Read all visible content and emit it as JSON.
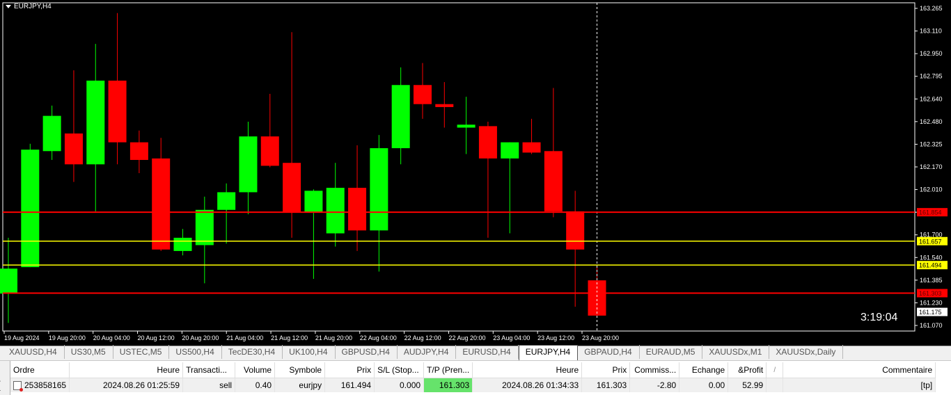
{
  "chart": {
    "title": "EURJPY,H4",
    "countdown": "3:19:04",
    "colors": {
      "background": "#000000",
      "bull": "#00ff00",
      "bear": "#ff0000",
      "axis": "#ffffff",
      "stop_line": "#ff0000",
      "entry_line": "#ffff00"
    }
  },
  "chart_data": {
    "type": "candlestick",
    "symbol": "EURJPY",
    "timeframe": "H4",
    "y_ticks": [
      "163.265",
      "163.110",
      "162.950",
      "162.795",
      "162.640",
      "162.480",
      "162.325",
      "162.170",
      "162.010",
      "161.855",
      "161.700",
      "161.540",
      "161.385",
      "161.230",
      "161.070"
    ],
    "x_ticks": [
      "19 Aug 2024",
      "19 Aug 20:00",
      "20 Aug 04:00",
      "20 Aug 12:00",
      "20 Aug 20:00",
      "21 Aug 04:00",
      "21 Aug 12:00",
      "21 Aug 20:00",
      "22 Aug 04:00",
      "22 Aug 12:00",
      "22 Aug 20:00",
      "23 Aug 04:00",
      "23 Aug 12:00",
      "23 Aug 20:00"
    ],
    "ylim": [
      161.045,
      163.28
    ],
    "price_labels": [
      {
        "price": 161.854,
        "label": "161.854",
        "kind": "stop"
      },
      {
        "price": 161.657,
        "label": "161.657",
        "kind": "entry"
      },
      {
        "price": 161.494,
        "label": "161.494",
        "kind": "entry"
      },
      {
        "price": 161.303,
        "label": "161.303",
        "kind": "stop"
      },
      {
        "price": 161.175,
        "label": "161.175",
        "kind": "bid"
      }
    ],
    "candles": [
      {
        "o": 161.3,
        "h": 161.68,
        "l": 161.1,
        "c": 161.47
      },
      {
        "o": 161.48,
        "h": 162.32,
        "l": 161.48,
        "c": 162.28
      },
      {
        "o": 162.27,
        "h": 162.58,
        "l": 162.21,
        "c": 162.51
      },
      {
        "o": 162.39,
        "h": 162.82,
        "l": 162.06,
        "c": 162.18
      },
      {
        "o": 162.18,
        "h": 163.0,
        "l": 161.86,
        "c": 162.75
      },
      {
        "o": 162.75,
        "h": 163.21,
        "l": 162.18,
        "c": 162.33
      },
      {
        "o": 162.33,
        "h": 162.41,
        "l": 162.12,
        "c": 162.21
      },
      {
        "o": 162.22,
        "h": 162.36,
        "l": 161.59,
        "c": 161.6
      },
      {
        "o": 161.59,
        "h": 161.74,
        "l": 161.56,
        "c": 161.68
      },
      {
        "o": 161.63,
        "h": 161.96,
        "l": 161.37,
        "c": 161.87
      },
      {
        "o": 161.87,
        "h": 162.05,
        "l": 161.64,
        "c": 161.99
      },
      {
        "o": 161.99,
        "h": 162.47,
        "l": 161.84,
        "c": 162.37
      },
      {
        "o": 162.37,
        "h": 162.66,
        "l": 162.16,
        "c": 162.17
      },
      {
        "o": 162.19,
        "h": 163.08,
        "l": 161.68,
        "c": 161.85
      },
      {
        "o": 161.85,
        "h": 162.01,
        "l": 161.4,
        "c": 162.0
      },
      {
        "o": 161.71,
        "h": 162.19,
        "l": 161.62,
        "c": 162.02
      },
      {
        "o": 162.02,
        "h": 162.31,
        "l": 161.59,
        "c": 161.73
      },
      {
        "o": 161.73,
        "h": 162.38,
        "l": 161.45,
        "c": 162.29
      },
      {
        "o": 162.29,
        "h": 162.84,
        "l": 162.18,
        "c": 162.72
      },
      {
        "o": 162.72,
        "h": 162.87,
        "l": 162.49,
        "c": 162.59
      },
      {
        "o": 162.59,
        "h": 162.74,
        "l": 162.43,
        "c": 162.57
      },
      {
        "o": 162.43,
        "h": 162.64,
        "l": 162.25,
        "c": 162.45
      },
      {
        "o": 162.44,
        "h": 162.47,
        "l": 161.68,
        "c": 162.22
      },
      {
        "o": 162.22,
        "h": 162.33,
        "l": 161.71,
        "c": 162.33
      },
      {
        "o": 162.33,
        "h": 162.49,
        "l": 162.25,
        "c": 162.26
      },
      {
        "o": 162.27,
        "h": 162.7,
        "l": 161.82,
        "c": 161.86
      },
      {
        "o": 161.86,
        "h": 162.0,
        "l": 161.21,
        "c": 161.6
      },
      {
        "o": 161.39,
        "h": 161.49,
        "l": 161.14,
        "c": 161.15
      }
    ]
  },
  "tabs": [
    {
      "label": "XAUUSD,H4",
      "active": false
    },
    {
      "label": "US30,M5",
      "active": false
    },
    {
      "label": "USTEC,M5",
      "active": false
    },
    {
      "label": "US500,H4",
      "active": false
    },
    {
      "label": "TecDE30,H4",
      "active": false
    },
    {
      "label": "UK100,H4",
      "active": false
    },
    {
      "label": "GBPUSD,H4",
      "active": false
    },
    {
      "label": "AUDJPY,H4",
      "active": false
    },
    {
      "label": "EURUSD,H4",
      "active": false
    },
    {
      "label": "EURJPY,H4",
      "active": true
    },
    {
      "label": "GBPAUD,H4",
      "active": false
    },
    {
      "label": "EURAUD,M5",
      "active": false
    },
    {
      "label": "XAUUSDx,M1",
      "active": false
    },
    {
      "label": "XAUUSDx,Daily",
      "active": false
    }
  ],
  "terminal": {
    "side_label": "inal",
    "headers": [
      "Ordre",
      "Heure",
      "Transacti...",
      "Volume",
      "Symbole",
      "Prix",
      "S/L (Stop...",
      "T/P (Pren...",
      "Heure",
      "Prix",
      "Commiss...",
      "Echange",
      "&Profit",
      "/",
      "Commentaire"
    ],
    "row": {
      "ordre": "253858165",
      "heure": "2024.08.26 01:25:59",
      "transaction": "sell",
      "volume": "0.40",
      "symbole": "eurjpy",
      "prix": "161.494",
      "sl": "0.000",
      "tp": "161.303",
      "heure2": "2024.08.26 01:34:33",
      "prix2": "161.303",
      "commission": "-2.80",
      "echange": "0.00",
      "profit": "52.99",
      "commentaire": "[tp]"
    }
  }
}
